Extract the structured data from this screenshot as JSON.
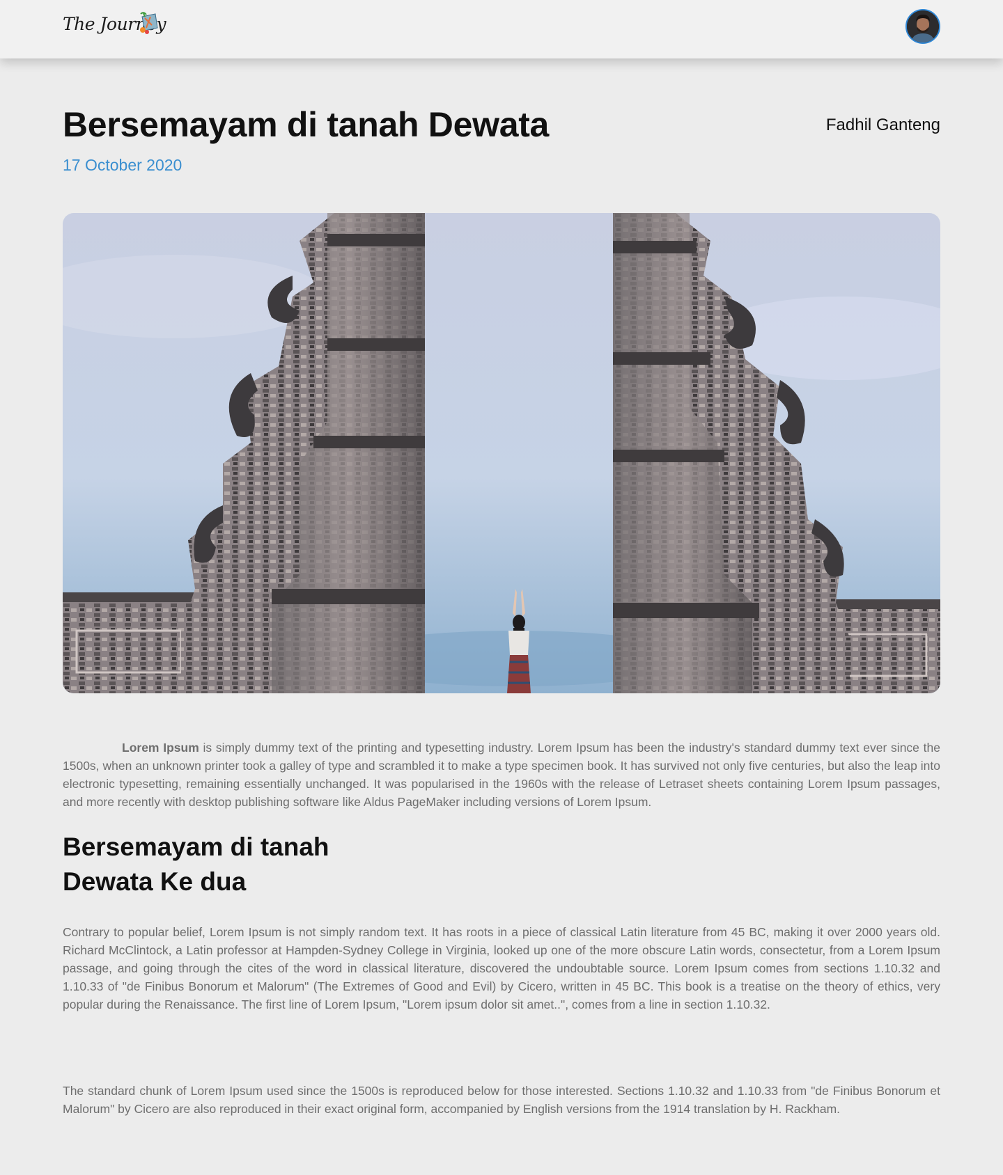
{
  "header": {
    "logo_text": "The Journey",
    "logo_icon": "map-icon",
    "avatar_icon": "user-avatar"
  },
  "article": {
    "title": "Bersemayam di tanah Dewata",
    "author": "Fadhil Ganteng",
    "date": "17 October 2020",
    "hero_image": "temple-gate-photo",
    "para1_bold": "Lorem Ipsum",
    "para1_rest": " is simply dummy text of the printing and typesetting industry. Lorem Ipsum has been the industry's standard dummy text ever since the 1500s, when an unknown printer took a galley of type and scrambled it to make a type specimen book. It has survived not only five centuries, but also the leap into electronic typesetting, remaining essentially unchanged. It was popularised in the 1960s with the release of Letraset sheets containing Lorem Ipsum passages, and more recently with desktop publishing software like Aldus PageMaker including versions of Lorem Ipsum.",
    "subtitle_line1": "Bersemayam di tanah",
    "subtitle_line2": "Dewata Ke dua",
    "para2": "Contrary to popular belief, Lorem Ipsum is not simply random text. It has roots in a piece of classical Latin literature from 45 BC, making it over 2000 years old. Richard McClintock, a Latin professor at Hampden-Sydney College in Virginia, looked up one of the more obscure Latin words, consectetur, from a Lorem Ipsum passage, and going through the cites of the word in classical literature, discovered the undoubtable source. Lorem Ipsum comes from sections 1.10.32 and 1.10.33 of \"de Finibus Bonorum et Malorum\" (The Extremes of Good and Evil) by Cicero, written in 45 BC. This book is a treatise on the theory of ethics, very popular during the Renaissance. The first line of Lorem Ipsum, \"Lorem ipsum dolor sit amet..\", comes from a line in section 1.10.32.",
    "para3": "The standard chunk of Lorem Ipsum used since the 1500s is reproduced below for those interested. Sections 1.10.32 and 1.10.33 from \"de Finibus Bonorum et Malorum\" by Cicero are also reproduced in their exact original form, accompanied by English versions from the 1914 translation by H. Rackham."
  },
  "colors": {
    "accent": "#3b8fd0",
    "background": "#ececec",
    "header_bg": "#f1f1f1",
    "body_text": "#6e6e6e"
  }
}
